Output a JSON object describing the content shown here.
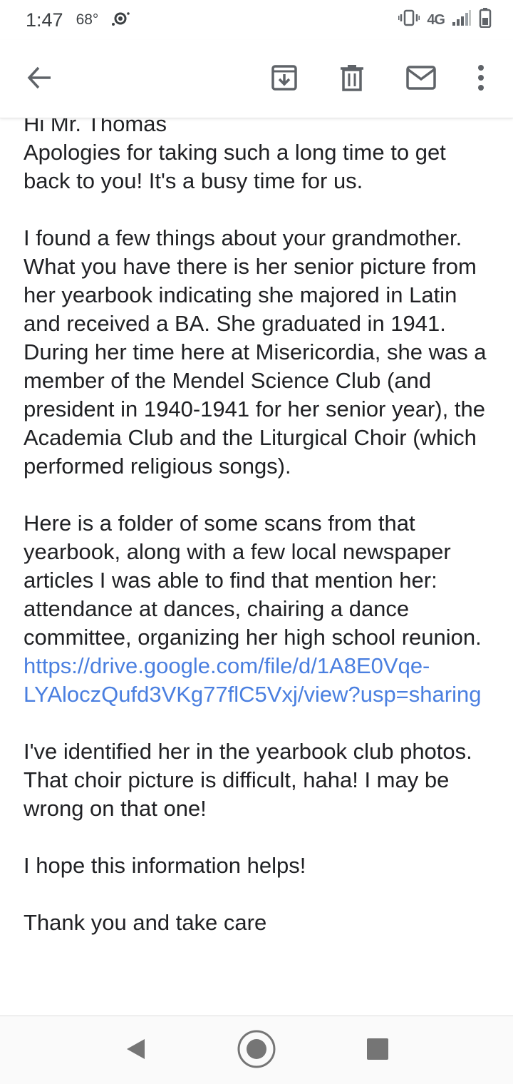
{
  "status_bar": {
    "time": "1:47",
    "temperature": "68°",
    "network": "4G"
  },
  "toolbar": {
    "icons": [
      "back-arrow-icon",
      "archive-icon",
      "delete-icon",
      "mark-unread-icon",
      "more-options-icon"
    ]
  },
  "email": {
    "paragraphs": [
      {
        "lines": [
          "Hi Mr. Thomas",
          "Apologies for taking such a long time to get back to you! It's a busy time for us."
        ]
      },
      {
        "lines": [
          "I found a few things about your grandmother. What you have there is her senior picture from her yearbook indicating she majored in Latin and received a BA. She graduated in 1941.",
          "During her time here at Misericordia, she was a member of the Mendel Science Club (and president in 1940-1941 for her senior year), the Academia Club and the Liturgical Choir (which performed religious songs)."
        ]
      },
      {
        "text": "Here is a folder of some scans from that yearbook, along with a few local newspaper articles I was able to find that mention her: attendance at dances, chairing a dance committee, organizing her high school reunion. ",
        "link": "https://drive.google.com/file/d/1A8E0Vqe-LYAloczQufd3VKg77flC5Vxj/view?usp=sharing"
      },
      {
        "lines": [
          "I've identified her in the yearbook club photos. That choir picture is difficult, haha! I may be wrong on that one!"
        ]
      },
      {
        "lines": [
          "I hope this information helps!"
        ]
      },
      {
        "lines": [
          "Thank you and take care"
        ]
      }
    ]
  },
  "colors": {
    "link": "#4a7fe0",
    "text": "#202124",
    "icon": "#5f6368"
  }
}
